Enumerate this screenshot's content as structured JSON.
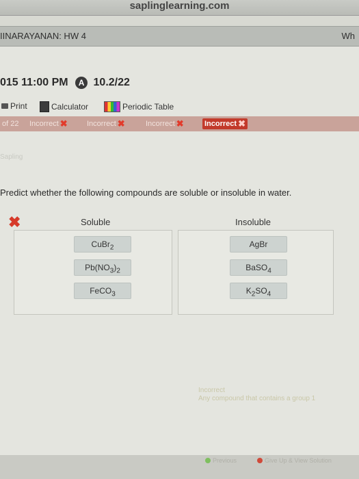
{
  "browser": {
    "url": "saplinglearning.com"
  },
  "course": {
    "title": "IINARAYANAN: HW 4",
    "right_text": "Wh"
  },
  "due": {
    "time": "015 11:00 PM",
    "late_icon_letter": "A",
    "score": "10.2/22"
  },
  "toolbar": {
    "print": "Print",
    "calculator": "Calculator",
    "periodic_table": "Periodic Table"
  },
  "attempts": {
    "question_number": "of 22",
    "items": [
      "Incorrect",
      "Incorrect",
      "Incorrect",
      "Incorrect"
    ]
  },
  "faded_label": "Sapling",
  "question": {
    "text": "Predict whether the following compounds are soluble or insoluble in water."
  },
  "bins": {
    "soluble": {
      "label": "Soluble"
    },
    "insoluble": {
      "label": "Insoluble"
    }
  },
  "feedback": {
    "title": "Incorrect",
    "text": "Any compound that contains a group 1"
  },
  "bottom": {
    "previous": "Previous",
    "give_up": "Give Up & View Solution"
  },
  "colors": {
    "incorrect": "#c23a2b",
    "status_bar": "#c9a39a"
  }
}
